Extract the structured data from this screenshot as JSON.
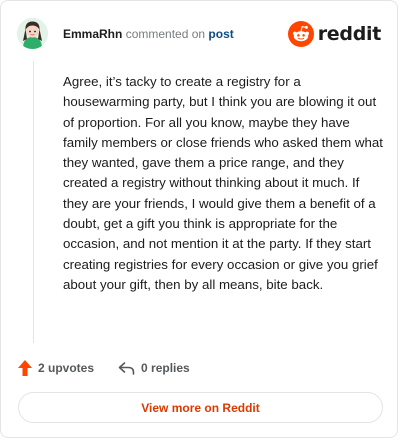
{
  "comment": {
    "username": "EmmaRhn",
    "action_text": "commented on",
    "post_link_label": "post",
    "body": "Agree, it’s tacky to create a registry for a housewarming party, but I think you are blowing it out of proportion. For all you know, maybe they have family members or close friends who asked them what they wanted, gave them a price range, and they created a registry without thinking about it much. If they are your friends, I would give them a benefit of a doubt, get a gift you think is appropriate for the occasion, and not mention it at the party. If they start creating registries for every occasion or give you grief about your gift, then by all means, bite back."
  },
  "brand": {
    "name": "reddit",
    "icon": "reddit-logo-icon",
    "color": "#ff4500"
  },
  "actions": {
    "upvotes_label": "2 upvotes",
    "replies_label": "0 replies",
    "upvote_icon": "upvote-arrow-icon",
    "reply_icon": "reply-arrow-icon",
    "upvote_color": "#ff4500"
  },
  "footer": {
    "view_more_label": "View more on Reddit",
    "link_color": "#d93a00"
  }
}
